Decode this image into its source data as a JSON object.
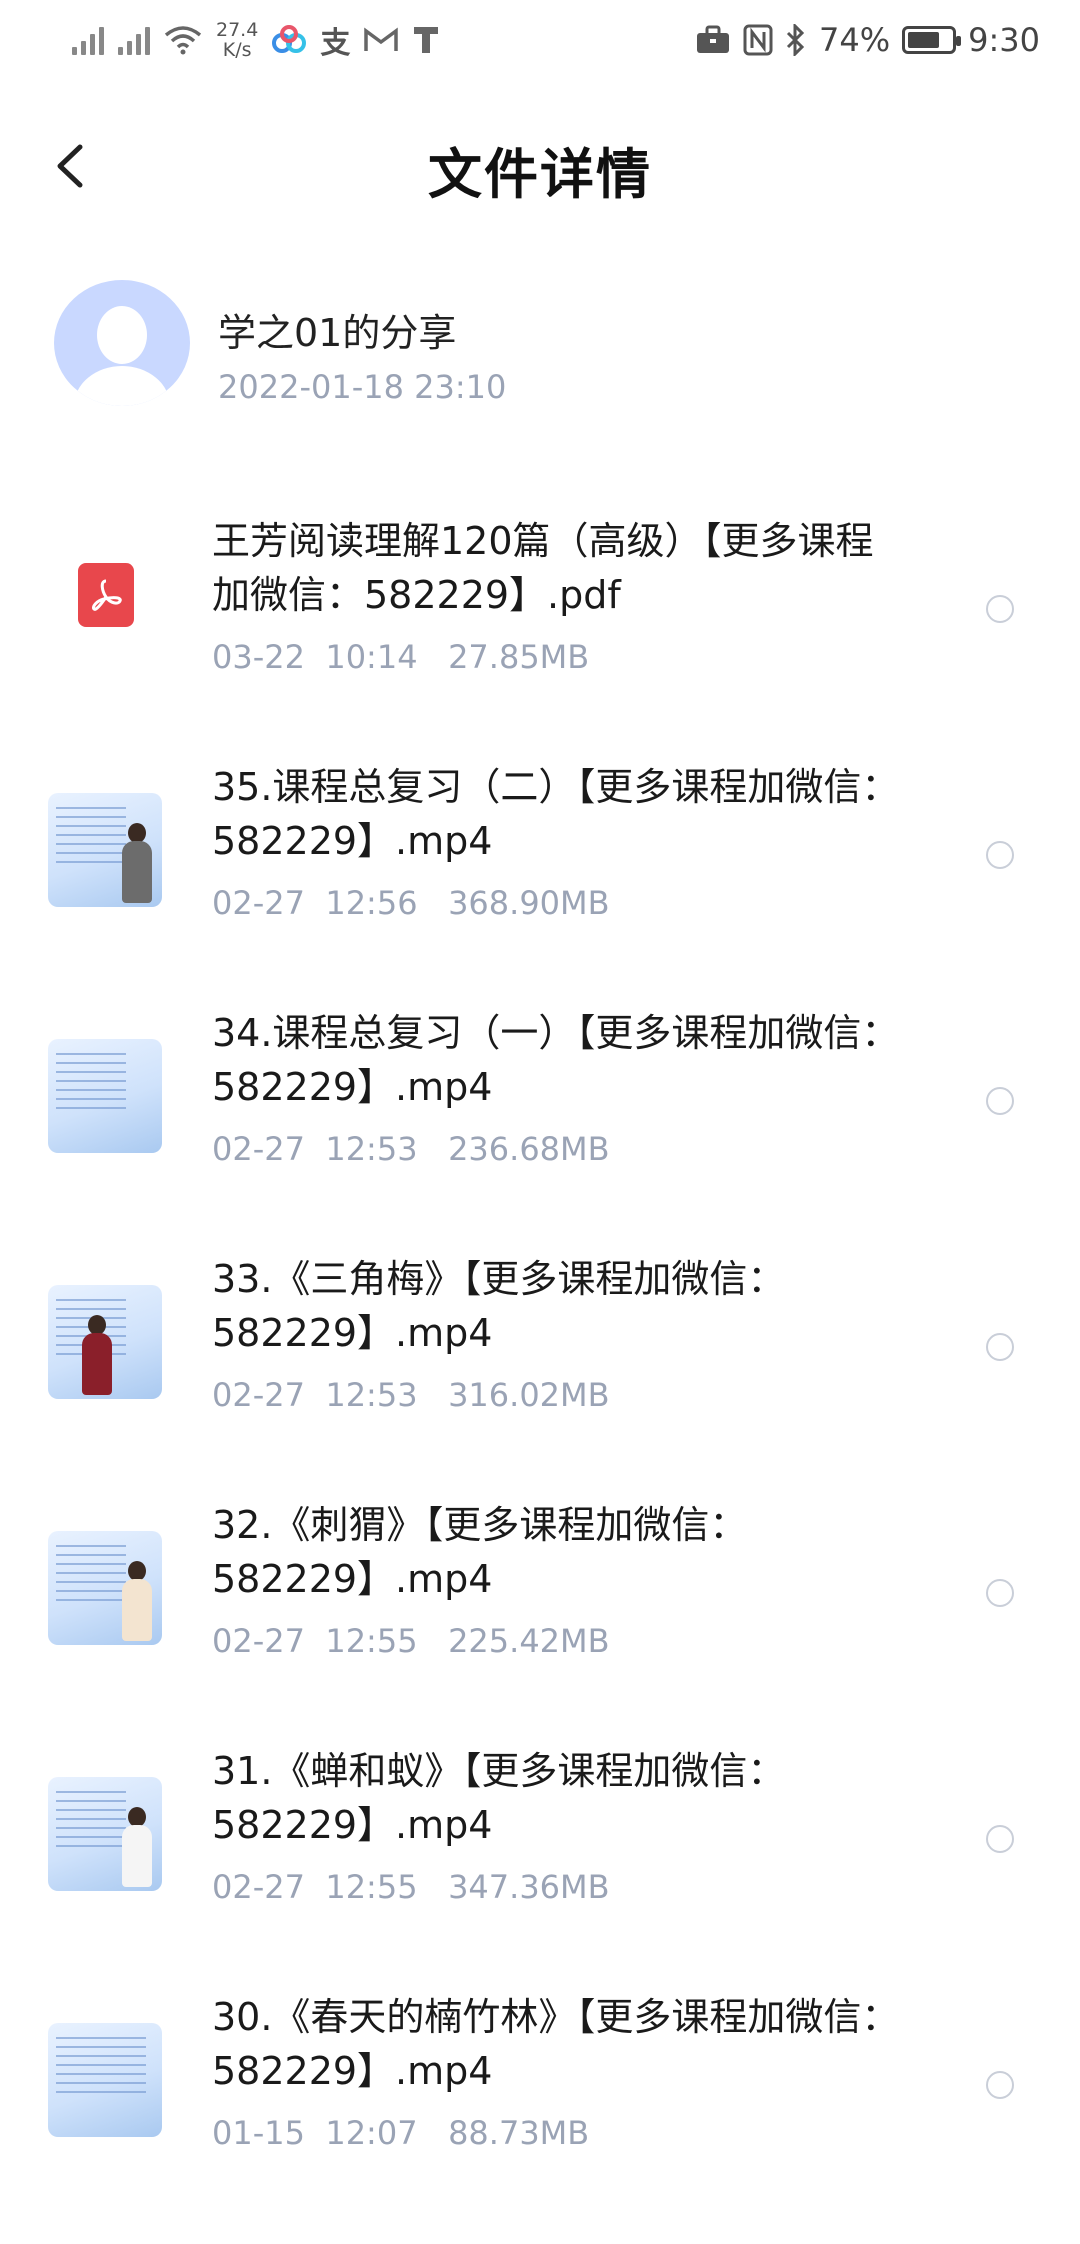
{
  "status_bar": {
    "net_speed_value": "27.4",
    "net_speed_unit": "K/s",
    "battery_percent_text": "74%",
    "battery_level": 0.74,
    "time": "9:30",
    "icons": [
      "signal-icon",
      "signal-roaming-icon",
      "wifi-icon",
      "baidu-netdisk-icon",
      "alipay-icon",
      "gmail-icon",
      "t-app-icon",
      "briefcase-icon",
      "nfc-icon",
      "bluetooth-icon",
      "battery-icon"
    ]
  },
  "header": {
    "title": "文件详情",
    "back_icon": "chevron-left-icon"
  },
  "sharer": {
    "name": "学之01的分享",
    "time": "2022-01-18  23:10"
  },
  "files": [
    {
      "name": "王芳阅读理解120篇（高级）【更多课程加微信：582229】.pdf",
      "date": "03-22",
      "time": "10:14",
      "size": "27.85MB",
      "type": "pdf"
    },
    {
      "name": "35.课程总复习（二）【更多课程加微信：582229】.mp4",
      "date": "02-27",
      "time": "12:56",
      "size": "368.90MB",
      "type": "video"
    },
    {
      "name": "34.课程总复习（一）【更多课程加微信：582229】.mp4",
      "date": "02-27",
      "time": "12:53",
      "size": "236.68MB",
      "type": "video"
    },
    {
      "name": "33.《三角梅》【更多课程加微信：582229】.mp4",
      "date": "02-27",
      "time": "12:53",
      "size": "316.02MB",
      "type": "video"
    },
    {
      "name": "32.《刺猬》【更多课程加微信：582229】.mp4",
      "date": "02-27",
      "time": "12:55",
      "size": "225.42MB",
      "type": "video"
    },
    {
      "name": "31.《蝉和蚁》【更多课程加微信：582229】.mp4",
      "date": "02-27",
      "time": "12:55",
      "size": "347.36MB",
      "type": "video"
    },
    {
      "name": "30.《春天的楠竹林》【更多课程加微信：582229】.mp4",
      "date": "01-15",
      "time": "12:07",
      "size": "88.73MB",
      "type": "video"
    }
  ]
}
